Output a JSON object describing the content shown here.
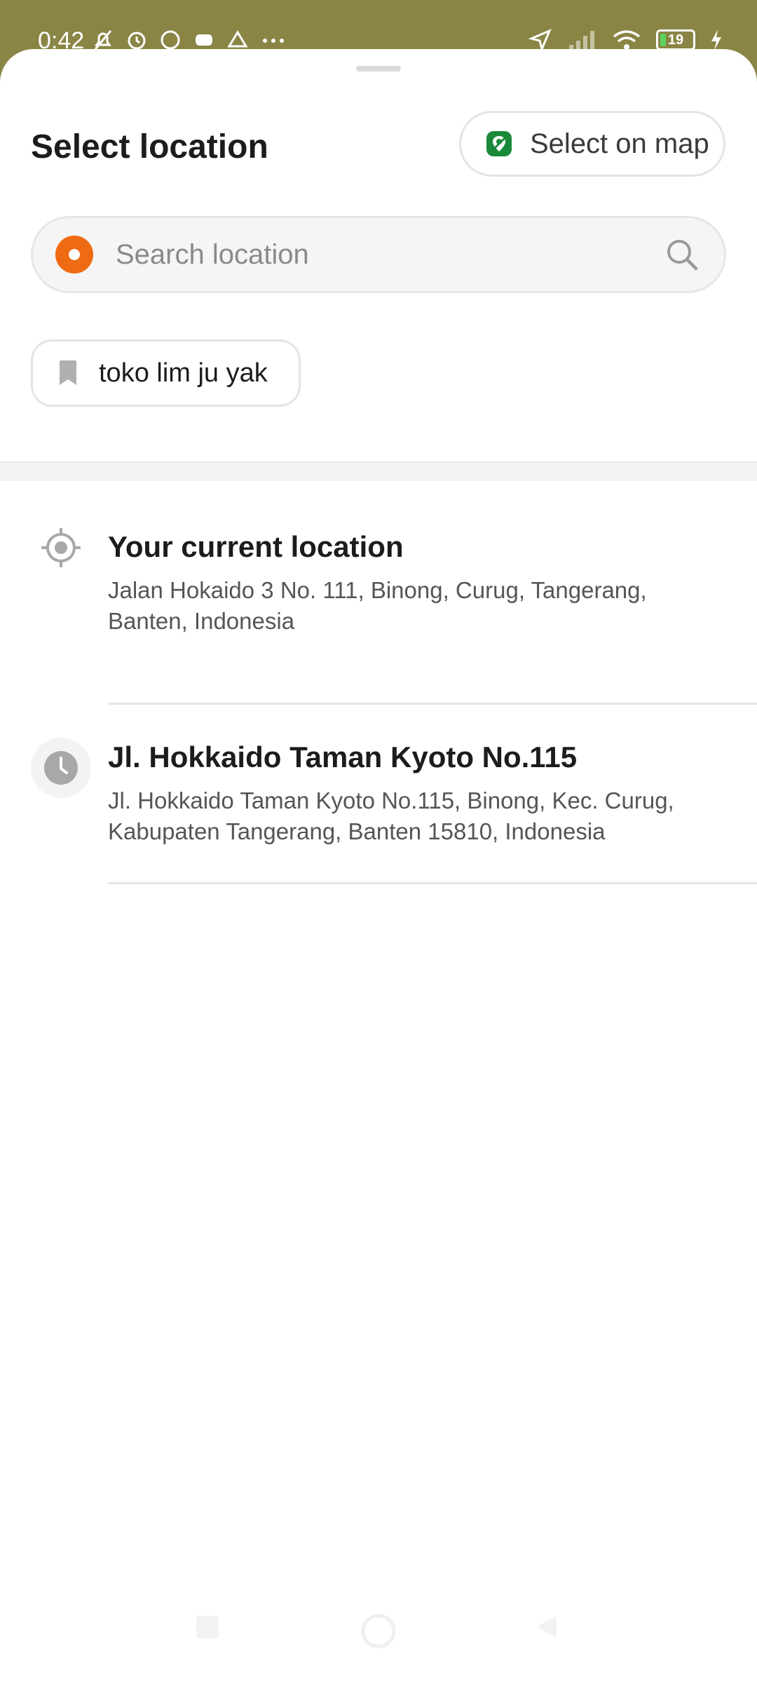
{
  "status_bar": {
    "time": "0:42",
    "battery": "19"
  },
  "sheet": {
    "title": "Select location",
    "map_button_label": "Select on map",
    "search": {
      "placeholder": "Search location"
    },
    "saved_places": [
      {
        "label": "toko lim ju yak"
      }
    ],
    "locations": [
      {
        "type": "current",
        "title": "Your current location",
        "address": "Jalan Hokaido 3 No. 111, Binong, Curug, Tangerang, Banten, Indonesia"
      },
      {
        "type": "recent",
        "title": "Jl. Hokkaido Taman Kyoto No.115",
        "address": "Jl. Hokkaido Taman Kyoto No.115, Binong, Kec. Curug, Kabupaten Tangerang, Banten 15810, Indonesia"
      }
    ]
  },
  "colors": {
    "status_bar_bg": "#8a8545",
    "accent_orange": "#ee6a13",
    "map_icon_green": "#1a8a3a"
  },
  "icons": {
    "map": "map-pin-icon",
    "search": "search-icon",
    "bookmark": "bookmark-icon",
    "current": "crosshair-icon",
    "recent": "clock-icon"
  }
}
